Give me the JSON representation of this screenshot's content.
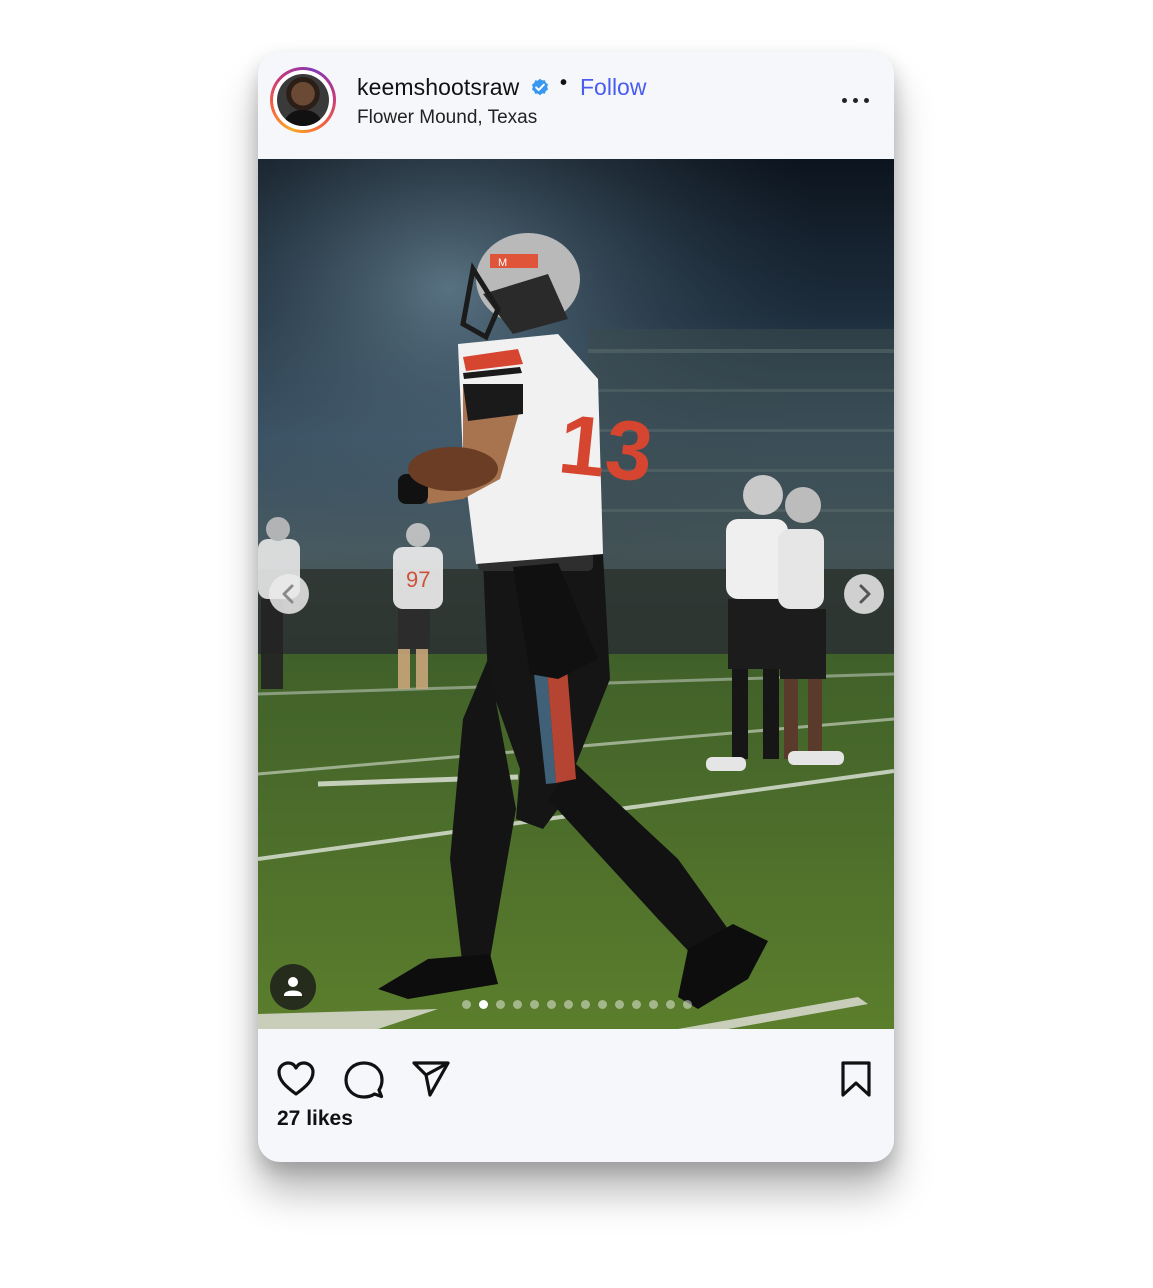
{
  "post": {
    "username": "keemshootsraw",
    "verified": true,
    "separator": "•",
    "follow_label": "Follow",
    "location": "Flower Mound, Texas",
    "more_icon": "more-horizontal-icon"
  },
  "carousel": {
    "total_slides": 14,
    "active_index": 1,
    "prev_icon": "chevron-left-icon",
    "next_icon": "chevron-right-icon",
    "tag_icon": "user-tag-icon"
  },
  "actions": {
    "like_icon": "heart-icon",
    "comment_icon": "comment-icon",
    "share_icon": "send-icon",
    "save_icon": "bookmark-icon"
  },
  "likes_text": "27 likes",
  "colors": {
    "follow": "#4a5cf0",
    "verified": "#3897f0",
    "card_bg": "#f5f7fb"
  }
}
